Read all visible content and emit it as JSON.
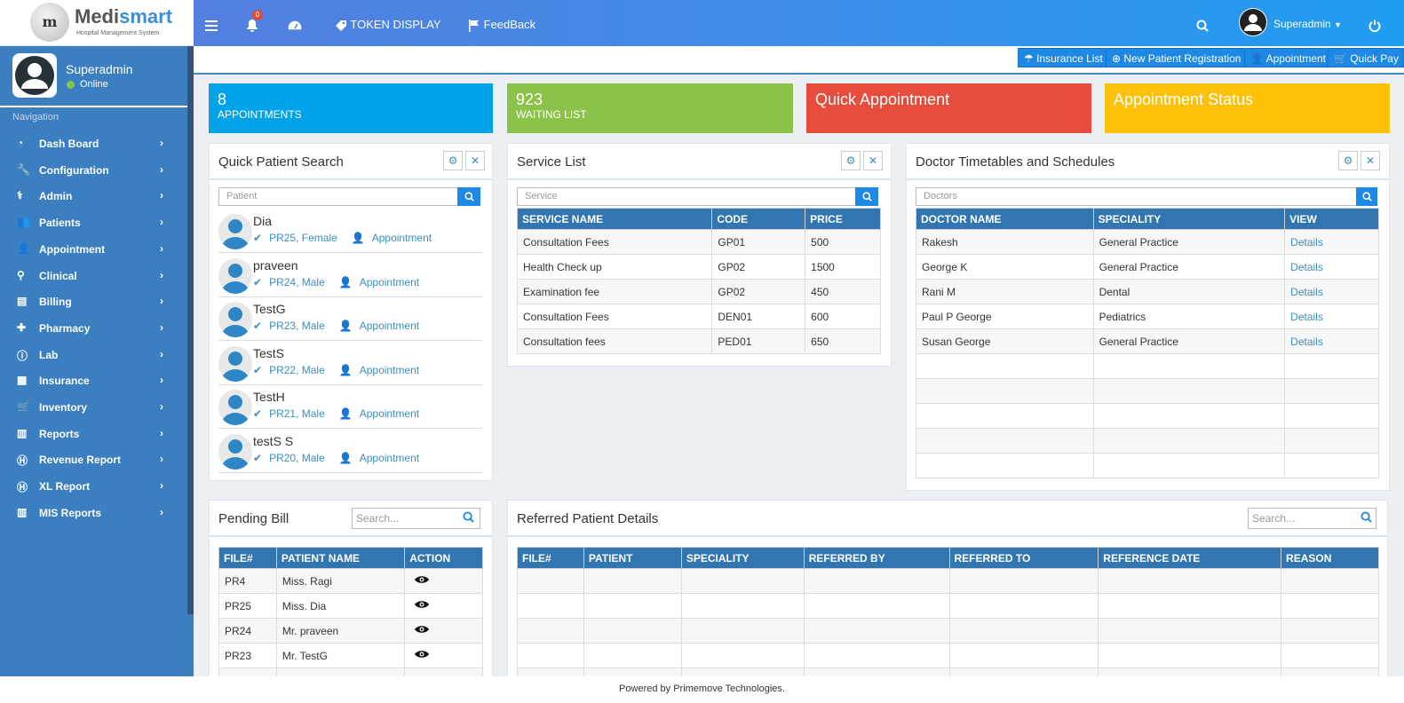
{
  "logo": {
    "mark": "m",
    "brand_main": "Medi",
    "brand_second": "smart",
    "tagline": "Hospital Management System"
  },
  "topbar": {
    "token_label": "TOKEN DISPLAY",
    "feedback_label": "FeedBack",
    "notification_count": "0",
    "user_label": "Superadmin"
  },
  "sidebar": {
    "user_name": "Superadmin",
    "status": "Online",
    "nav_header": "Navigation",
    "items": [
      {
        "label": "Dash Board",
        "icon": "dashboard-icon"
      },
      {
        "label": "Configuration",
        "icon": "wrench-icon"
      },
      {
        "label": "Admin",
        "icon": "user-md-icon"
      },
      {
        "label": "Patients",
        "icon": "users-icon"
      },
      {
        "label": "Appointment",
        "icon": "user-icon"
      },
      {
        "label": "Clinical",
        "icon": "stethoscope-icon"
      },
      {
        "label": "Billing",
        "icon": "money-icon"
      },
      {
        "label": "Pharmacy",
        "icon": "medkit-icon"
      },
      {
        "label": "Lab",
        "icon": "info-icon"
      },
      {
        "label": "Insurance",
        "icon": "briefcase-icon"
      },
      {
        "label": "Inventory",
        "icon": "cart-icon"
      },
      {
        "label": "Reports",
        "icon": "hospital-icon"
      },
      {
        "label": "Revenue Report",
        "icon": "h-square-icon"
      },
      {
        "label": "XL Report",
        "icon": "h-square-icon"
      },
      {
        "label": "MIS Reports",
        "icon": "hospital-icon"
      }
    ]
  },
  "actions": {
    "insurance_list": "Insurance List",
    "new_patient": "New Patient Registration",
    "appointment": "Appointment",
    "quick_pay": "Quick Pay"
  },
  "tiles": {
    "appointments": {
      "count": "8",
      "label": "APPOINTMENTS",
      "color": "#00a3e8"
    },
    "waiting": {
      "count": "923",
      "label": "WAITING LIST",
      "color": "#8bc34a"
    },
    "quick_appointment": {
      "label": "Quick Appointment",
      "color": "#e74c3c"
    },
    "appointment_status": {
      "label": "Appointment Status",
      "color": "#ffc107"
    }
  },
  "quick_patient_search": {
    "title": "Quick Patient Search",
    "placeholder": "Patient",
    "patients": [
      {
        "name": "Dia",
        "info": "PR25, Female",
        "action": "Appointment"
      },
      {
        "name": "praveen",
        "info": "PR24, Male",
        "action": "Appointment"
      },
      {
        "name": "TestG",
        "info": "PR23, Male",
        "action": "Appointment"
      },
      {
        "name": "TestS",
        "info": "PR22, Male",
        "action": "Appointment"
      },
      {
        "name": "TestH",
        "info": "PR21, Male",
        "action": "Appointment"
      },
      {
        "name": "testS S",
        "info": "PR20, Male",
        "action": "Appointment"
      }
    ]
  },
  "service_list": {
    "title": "Service List",
    "placeholder": "Service",
    "headers": [
      "SERVICE NAME",
      "CODE",
      "PRICE"
    ],
    "rows": [
      [
        "Consultation Fees",
        "GP01",
        "500"
      ],
      [
        "Health Check up",
        "GP02",
        "1500"
      ],
      [
        "Examination fee",
        "GP02",
        "450"
      ],
      [
        "Consultation Fees",
        "DEN01",
        "600"
      ],
      [
        "Consultation fees",
        "PED01",
        "650"
      ]
    ]
  },
  "doctor_timetable": {
    "title": "Doctor Timetables and Schedules",
    "placeholder": "Doctors",
    "headers": [
      "DOCTOR NAME",
      "SPECIALITY",
      "VIEW"
    ],
    "rows": [
      [
        "Rakesh",
        "General Practice",
        "Details"
      ],
      [
        "George K",
        "General Practice",
        "Details"
      ],
      [
        "Rani M",
        "Dental",
        "Details"
      ],
      [
        "Paul P George",
        "Pediatrics",
        "Details"
      ],
      [
        "Susan George",
        "General Practice",
        "Details"
      ]
    ]
  },
  "pending_bill": {
    "title": "Pending Bill",
    "placeholder": "Search...",
    "headers": [
      "FILE#",
      "PATIENT NAME",
      "ACTION"
    ],
    "rows": [
      [
        "PR4",
        "Miss. Ragi"
      ],
      [
        "PR25",
        "Miss. Dia"
      ],
      [
        "PR24",
        "Mr. praveen"
      ],
      [
        "PR23",
        "Mr. TestG"
      ]
    ]
  },
  "referred_patients": {
    "title": "Referred Patient Details",
    "placeholder": "Search...",
    "headers": [
      "FILE#",
      "PATIENT",
      "SPECIALITY",
      "REFERRED BY",
      "REFERRED TO",
      "REFERENCE DATE",
      "REASON"
    ]
  },
  "footer": {
    "text": "Powered by Primemove Technologies."
  }
}
